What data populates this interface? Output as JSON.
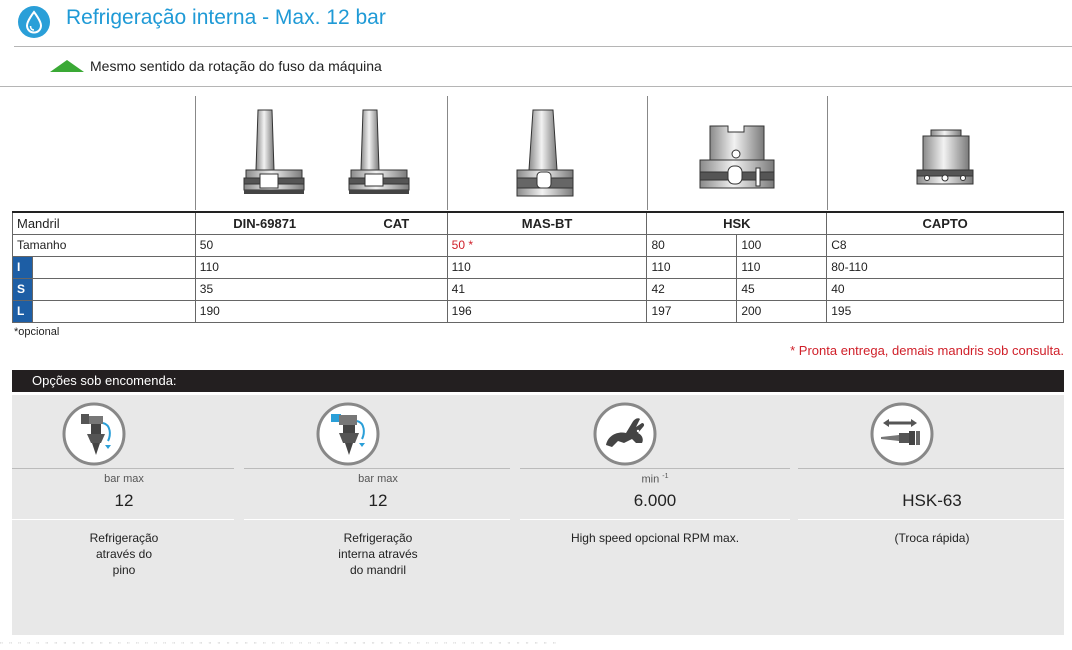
{
  "header": {
    "title": "Refrigeração interna - Max. 12 bar",
    "accent": "#1f9ad6"
  },
  "rotation": {
    "text": "Mesmo sentido da rotação do fuso da máquina",
    "color": "#3aa935"
  },
  "table": {
    "columns": {
      "mandril": "Mandril",
      "din": "DIN-69871",
      "cat": "CAT",
      "mas": "MAS-BT",
      "hsk": "HSK",
      "capto": "CAPTO"
    },
    "rows": {
      "tamanho": {
        "label": "Tamanho",
        "din": "50",
        "mas": "50 *",
        "hsk_a": "80",
        "hsk_b": "100",
        "capto": "C8"
      },
      "I": {
        "label": "I",
        "din": "110",
        "mas": "110",
        "hsk_a": "110",
        "hsk_b": "110",
        "capto": "80-110"
      },
      "S": {
        "label": "S",
        "din": "35",
        "mas": "41",
        "hsk_a": "42",
        "hsk_b": "45",
        "capto": "40"
      },
      "L": {
        "label": "L",
        "din": "190",
        "mas": "196",
        "hsk_a": "197",
        "hsk_b": "200",
        "capto": "195"
      }
    }
  },
  "notes": {
    "opcional": "*opcional",
    "pronta": "* Pronta entrega, demais mandris sob consulta."
  },
  "options": {
    "title": "Opções sob encomenda:",
    "items": [
      {
        "icon": "coolant-through-pin-icon",
        "small": "bar max",
        "big": "12",
        "desc1": "Refrigeração",
        "desc2": "através do",
        "desc3": "pino"
      },
      {
        "icon": "coolant-through-holder-icon",
        "small": "bar max",
        "big": "12",
        "desc1": "Refrigeração",
        "desc2": "interna através",
        "desc3": "do mandril"
      },
      {
        "icon": "rabbit-speed-icon",
        "small": "min",
        "small_sup": "-1",
        "big": "6.000",
        "desc1": "High speed opcional RPM max.",
        "desc2": "",
        "desc3": ""
      },
      {
        "icon": "quick-change-icon",
        "small": "",
        "big": "HSK-63",
        "desc1": "(Troca rápida)",
        "desc2": "",
        "desc3": ""
      }
    ]
  }
}
